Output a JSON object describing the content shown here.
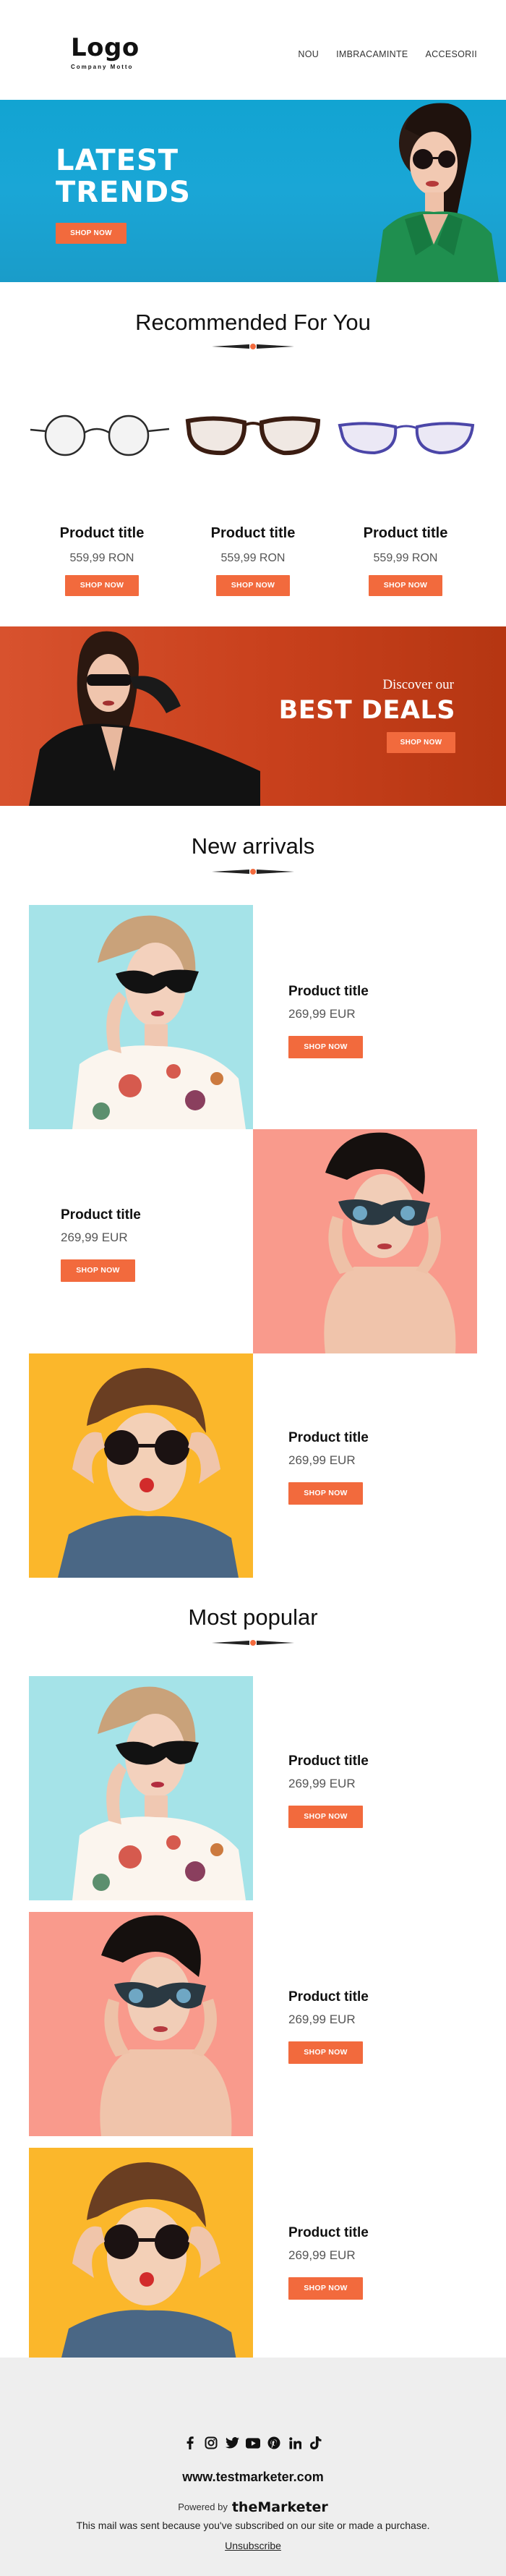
{
  "header": {
    "logo": "Logo",
    "logo_tagline": "Company Motto",
    "nav": [
      "NOU",
      "IMBRACAMINTE",
      "ACCESORII"
    ]
  },
  "hero": {
    "title_line1": "LATEST",
    "title_line2": "TRENDS",
    "button": "SHOP NOW",
    "background": "#18a5d5"
  },
  "recommended": {
    "title": "Recommended For You",
    "items": [
      {
        "name": "Product title",
        "price": "559,99 RON",
        "button": "SHOP NOW",
        "frame": "round-black"
      },
      {
        "name": "Product title",
        "price": "559,99 RON",
        "button": "SHOP NOW",
        "frame": "tortoise"
      },
      {
        "name": "Product title",
        "price": "559,99 RON",
        "button": "SHOP NOW",
        "frame": "blue"
      }
    ]
  },
  "deals": {
    "subtitle": "Discover our",
    "title": "BEST DEALS",
    "button": "SHOP NOW",
    "background": "#c8441f"
  },
  "new_arrivals": {
    "title": "New arrivals",
    "items": [
      {
        "name": "Product title",
        "price": "269,99 EUR",
        "button": "SHOP NOW",
        "bg": "#a5e3e8"
      },
      {
        "name": "Product title",
        "price": "269,99 EUR",
        "button": "SHOP NOW",
        "bg": "#f99a8c"
      },
      {
        "name": "Product title",
        "price": "269,99 EUR",
        "button": "SHOP NOW",
        "bg": "#fbb72b"
      }
    ]
  },
  "most_popular": {
    "title": "Most popular",
    "items": [
      {
        "name": "Product title",
        "price": "269,99 EUR",
        "button": "SHOP NOW",
        "bg": "#a5e3e8"
      },
      {
        "name": "Product title",
        "price": "269,99 EUR",
        "button": "SHOP NOW",
        "bg": "#f99a8c"
      },
      {
        "name": "Product title",
        "price": "269,99 EUR",
        "button": "SHOP NOW",
        "bg": "#fbb72b"
      }
    ]
  },
  "footer": {
    "socials": [
      "facebook-icon",
      "instagram-icon",
      "twitter-icon",
      "youtube-icon",
      "pinterest-icon",
      "linkedin-icon",
      "tiktok-icon"
    ],
    "website": "www.testmarketer.com",
    "powered_by": "Powered by",
    "brand": "theMarketer",
    "notice": "This mail was sent because you've subscribed on our site or made a purchase.",
    "unsubscribe": "Unsubscribe"
  },
  "colors": {
    "accent": "#f26a3d",
    "footer_bg": "#eeeeee"
  }
}
